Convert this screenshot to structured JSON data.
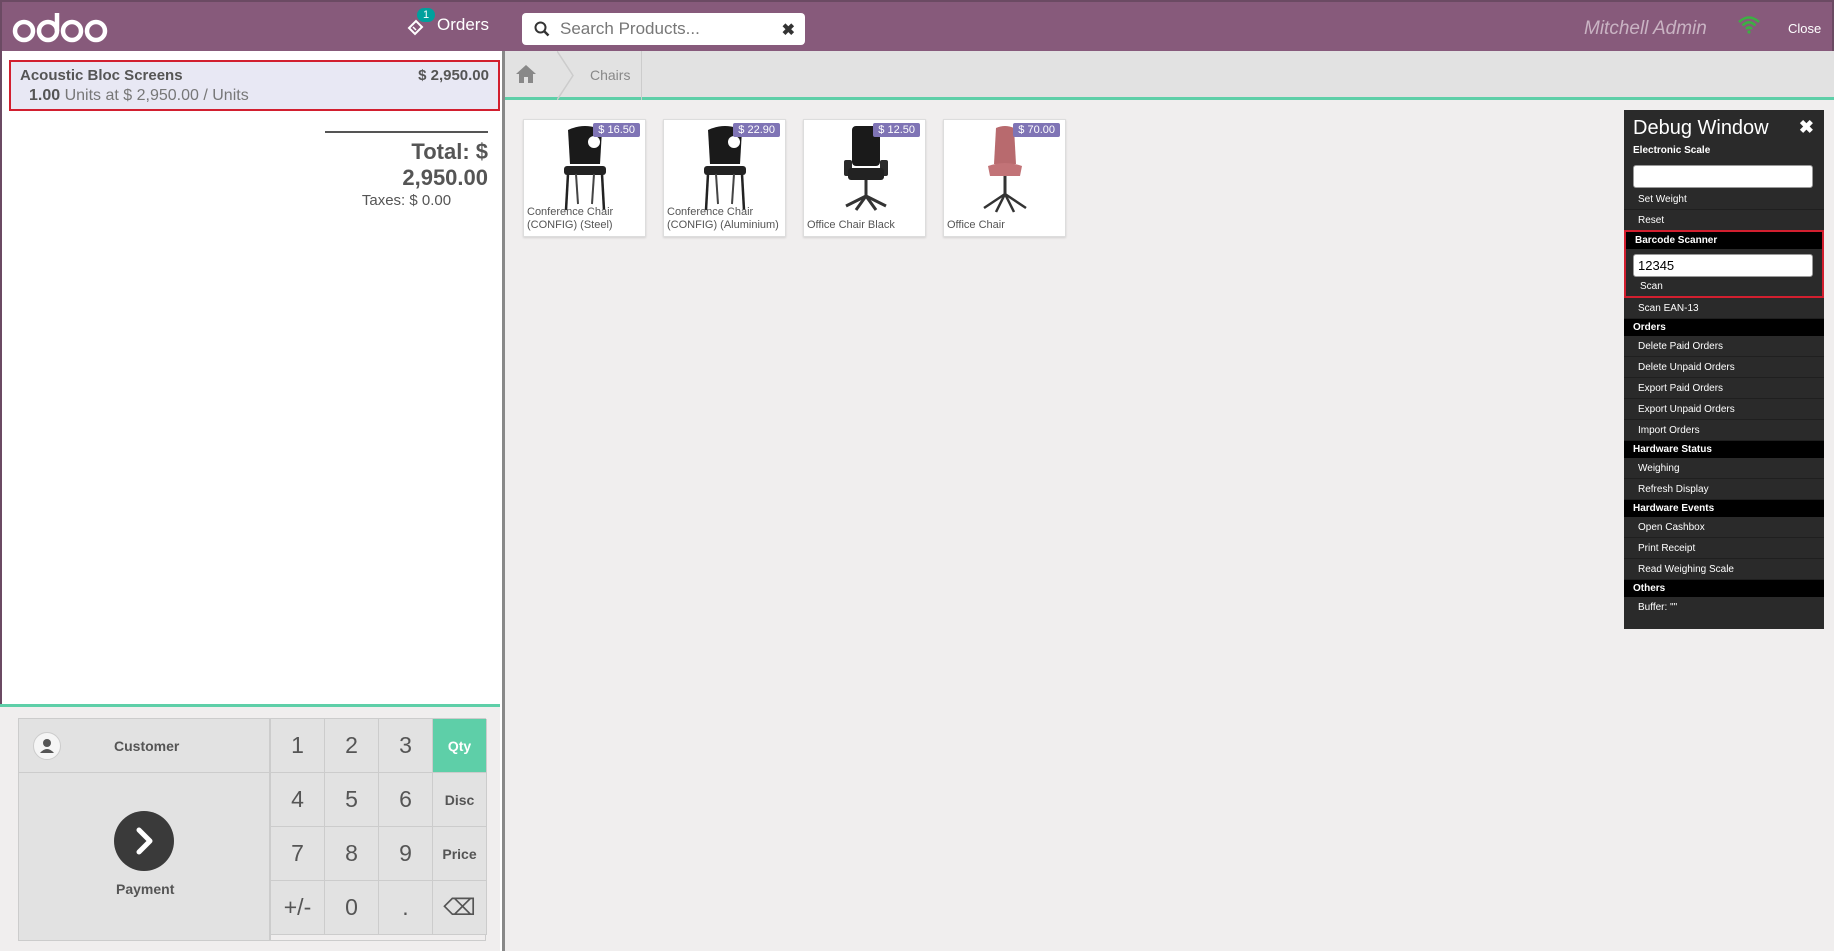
{
  "header": {
    "logo_text": "odoo",
    "orders_label": "Orders",
    "orders_count": "1",
    "search_placeholder": "Search Products...",
    "user_name": "Mitchell Admin",
    "close_label": "Close",
    "brand_color": "#875a7b"
  },
  "order": {
    "line": {
      "name": "Acoustic Bloc Screens",
      "price": "$ 2,950.00",
      "qty": "1.00",
      "unit_info": "Units at $ 2,950.00 / Units"
    },
    "total": "Total: $ 2,950.00",
    "taxes": "Taxes: $ 0.00"
  },
  "control": {
    "customer_label": "Customer",
    "payment_label": "Payment",
    "keys": [
      "1",
      "2",
      "3",
      "Qty",
      "4",
      "5",
      "6",
      "Disc",
      "7",
      "8",
      "9",
      "Price",
      "+/-",
      "0",
      ".",
      "⌫"
    ],
    "active_mode": "Qty",
    "accent_color": "#5ecfa8"
  },
  "breadcrumb": {
    "home_icon": "home-icon",
    "current": "Chairs"
  },
  "products": [
    {
      "name_line1": "Conference Chair",
      "name_line2": "(CONFIG) (Steel)",
      "price": "$ 16.50"
    },
    {
      "name_line1": "Conference Chair",
      "name_line2": "(CONFIG) (Aluminium)",
      "price": "$ 22.90"
    },
    {
      "name_line1": "Office Chair Black",
      "name_line2": "",
      "price": "$ 12.50"
    },
    {
      "name_line1": "Office Chair",
      "name_line2": "",
      "price": "$ 70.00"
    }
  ],
  "debug": {
    "title": "Debug Window",
    "scale_section": "Electronic Scale",
    "weight_value": "",
    "set_weight": "Set Weight",
    "reset": "Reset",
    "barcode_section": "Barcode Scanner",
    "barcode_value": "12345",
    "scan": "Scan",
    "scan_ean": "Scan EAN-13",
    "orders_section": "Orders",
    "delete_paid": "Delete Paid Orders",
    "delete_unpaid": "Delete Unpaid Orders",
    "export_paid": "Export Paid Orders",
    "export_unpaid": "Export Unpaid Orders",
    "import_orders": "Import Orders",
    "hw_status_section": "Hardware Status",
    "weighing": "Weighing",
    "refresh_display": "Refresh Display",
    "hw_events_section": "Hardware Events",
    "open_cashbox": "Open Cashbox",
    "print_receipt": "Print Receipt",
    "read_scale": "Read Weighing Scale",
    "others_section": "Others",
    "buffer": "Buffer: \"\""
  }
}
